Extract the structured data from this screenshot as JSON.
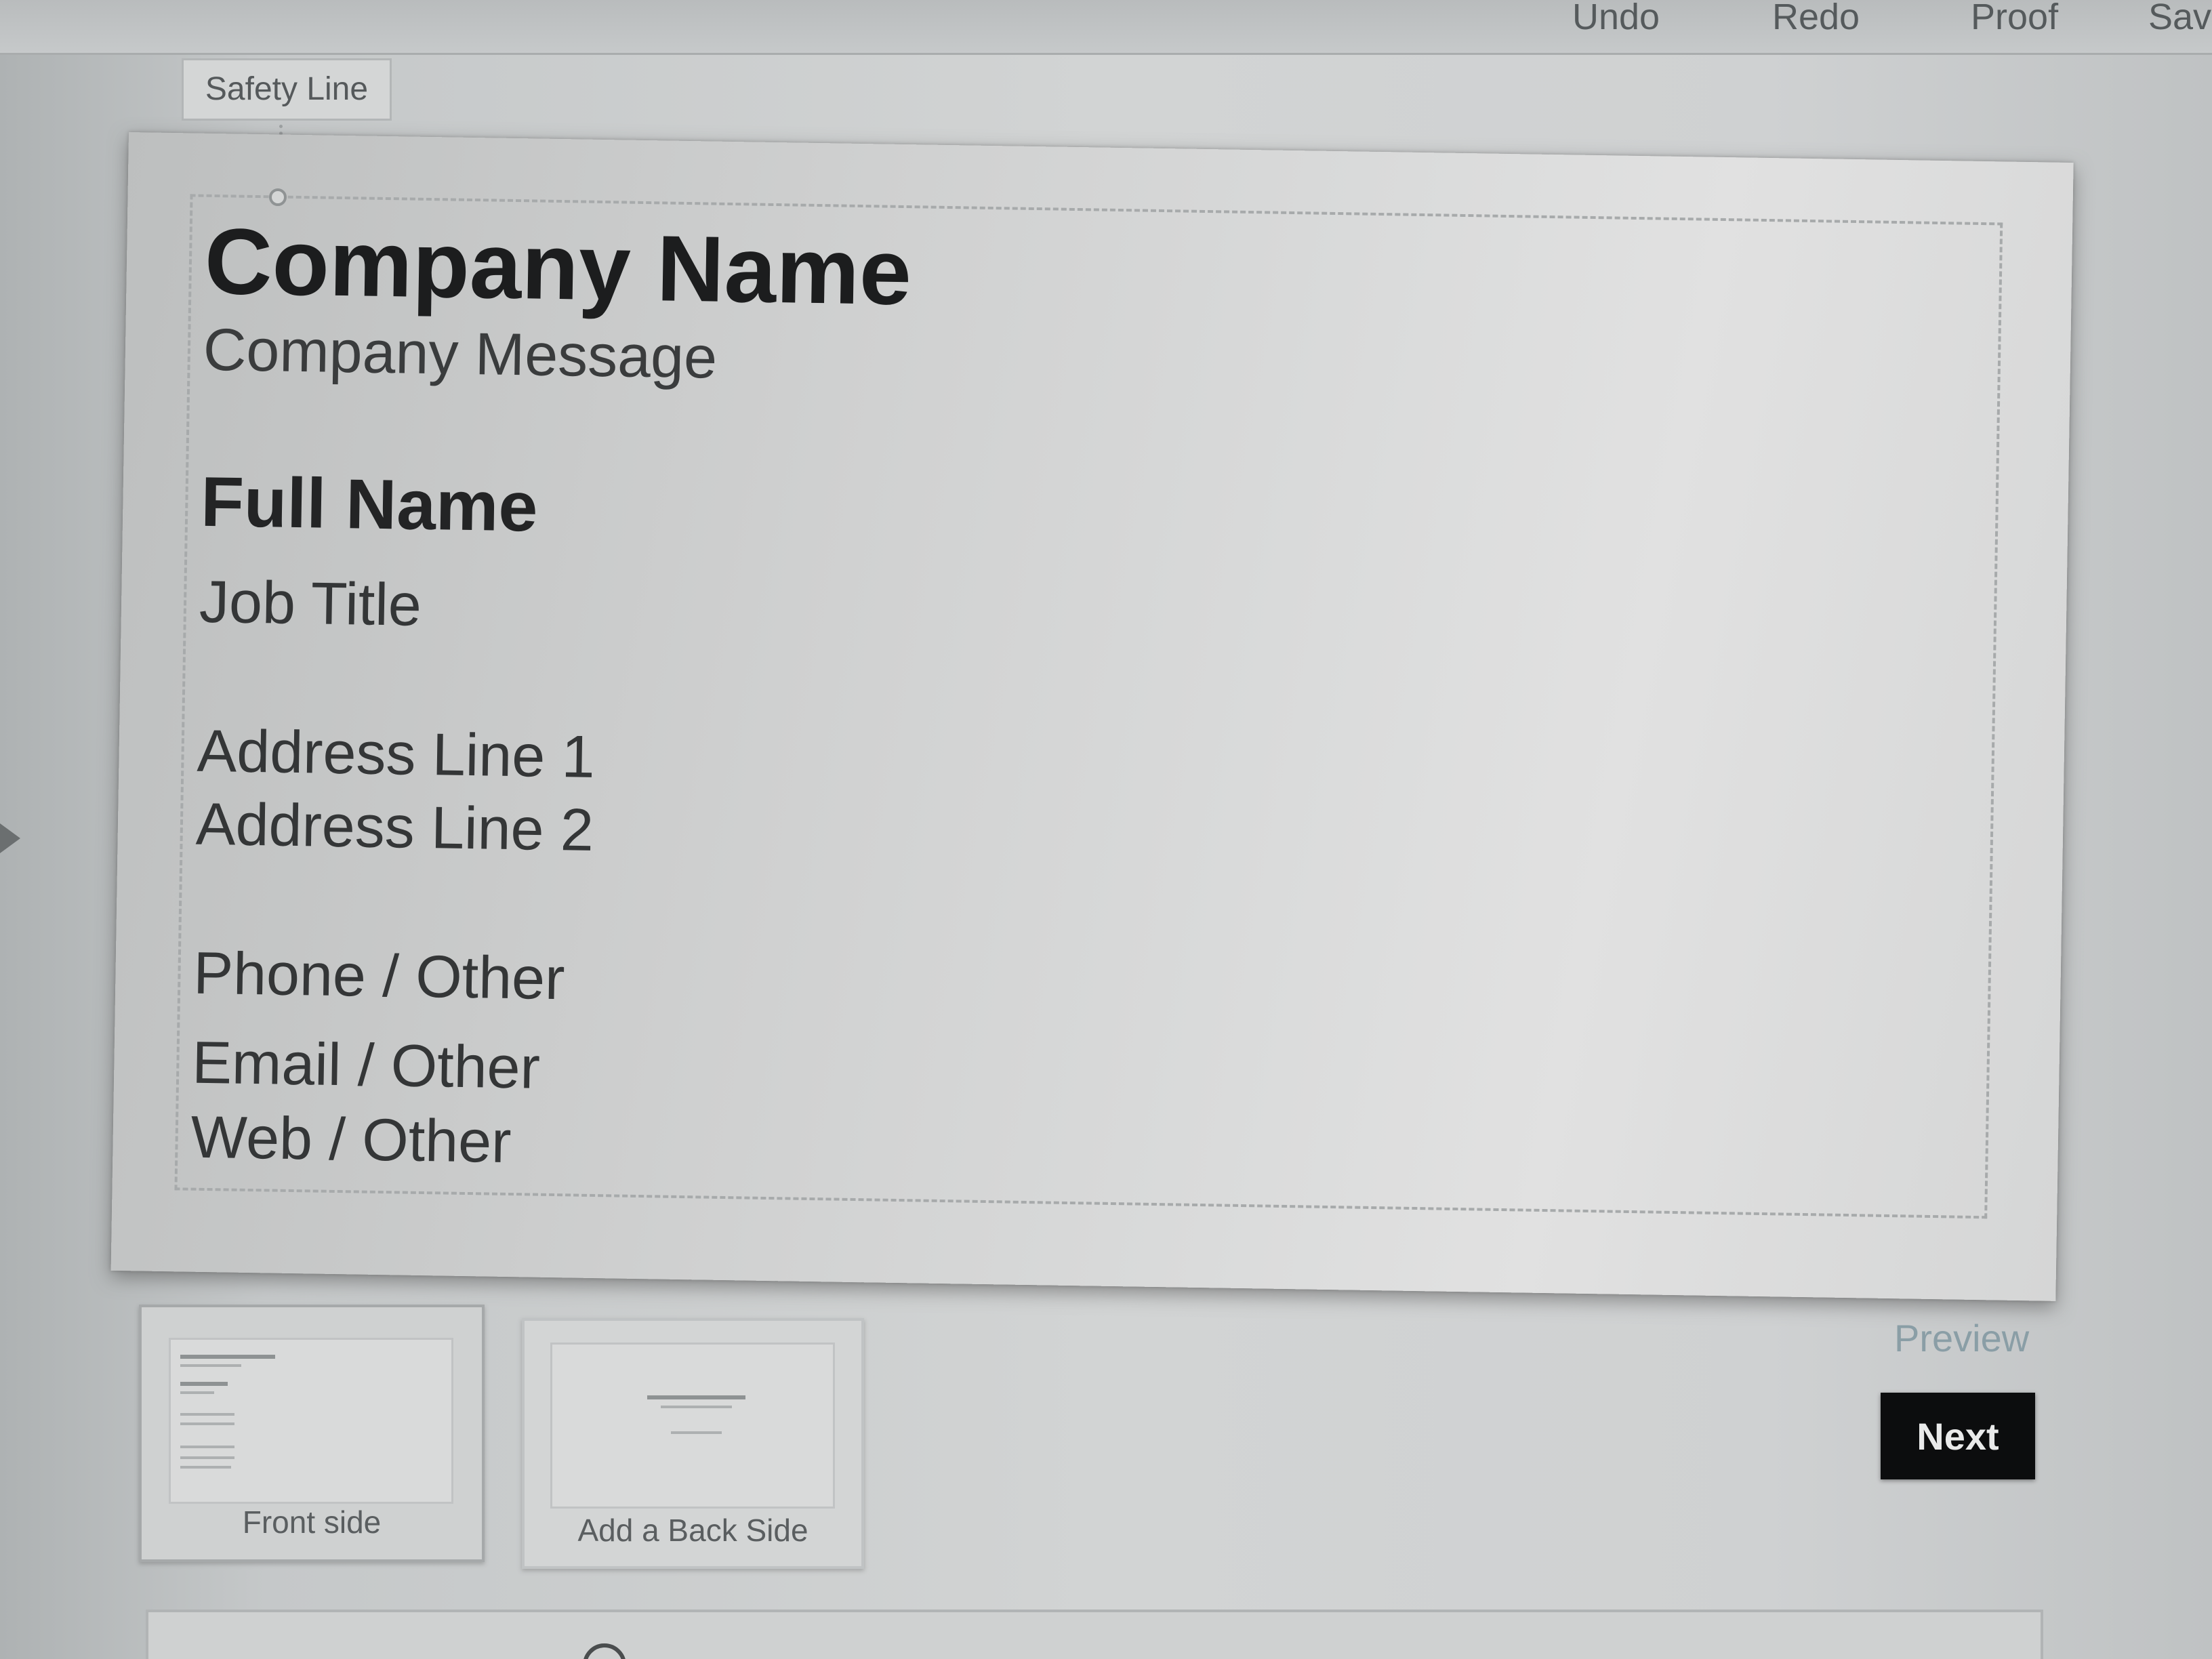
{
  "toolbar": {
    "undo_label": "Undo",
    "redo_label": "Redo",
    "proof_label": "Proof",
    "save_label": "Sav"
  },
  "safety_line": {
    "label": "Safety Line"
  },
  "card": {
    "company_name": "Company Name",
    "company_message": "Company Message",
    "full_name": "Full Name",
    "job_title": "Job Title",
    "address_line_1": "Address Line 1",
    "address_line_2": "Address Line 2",
    "phone": "Phone / Other",
    "email": "Email / Other",
    "web": "Web / Other"
  },
  "sides": {
    "front_label": "Front side",
    "back_label": "Add a Back Side"
  },
  "actions": {
    "preview_label": "Preview",
    "next_label": "Next"
  },
  "colors": {
    "next_button_bg": "#0c0d0e",
    "preview_link": "#8a9ea6"
  }
}
